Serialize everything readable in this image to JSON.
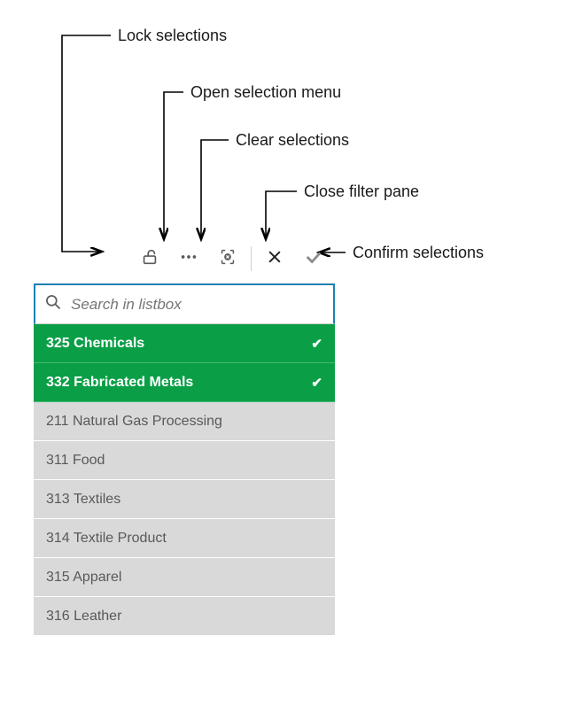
{
  "annotations": {
    "lock": "Lock selections",
    "menu": "Open selection menu",
    "clear": "Clear selections",
    "close": "Close filter pane",
    "confirm": "Confirm selections"
  },
  "search": {
    "placeholder": "Search in listbox"
  },
  "items": [
    {
      "label": "325 Chemicals",
      "selected": true
    },
    {
      "label": "332 Fabricated Metals",
      "selected": true
    },
    {
      "label": "211 Natural Gas Processing",
      "selected": false
    },
    {
      "label": "311 Food",
      "selected": false
    },
    {
      "label": "313 Textiles",
      "selected": false
    },
    {
      "label": "314 Textile Product",
      "selected": false
    },
    {
      "label": "315 Apparel",
      "selected": false
    },
    {
      "label": "316 Leather",
      "selected": false
    }
  ],
  "colors": {
    "selected_bg": "#0a9f46",
    "accent": "#1b7fb3",
    "unselected_bg": "#d9d9d9"
  }
}
